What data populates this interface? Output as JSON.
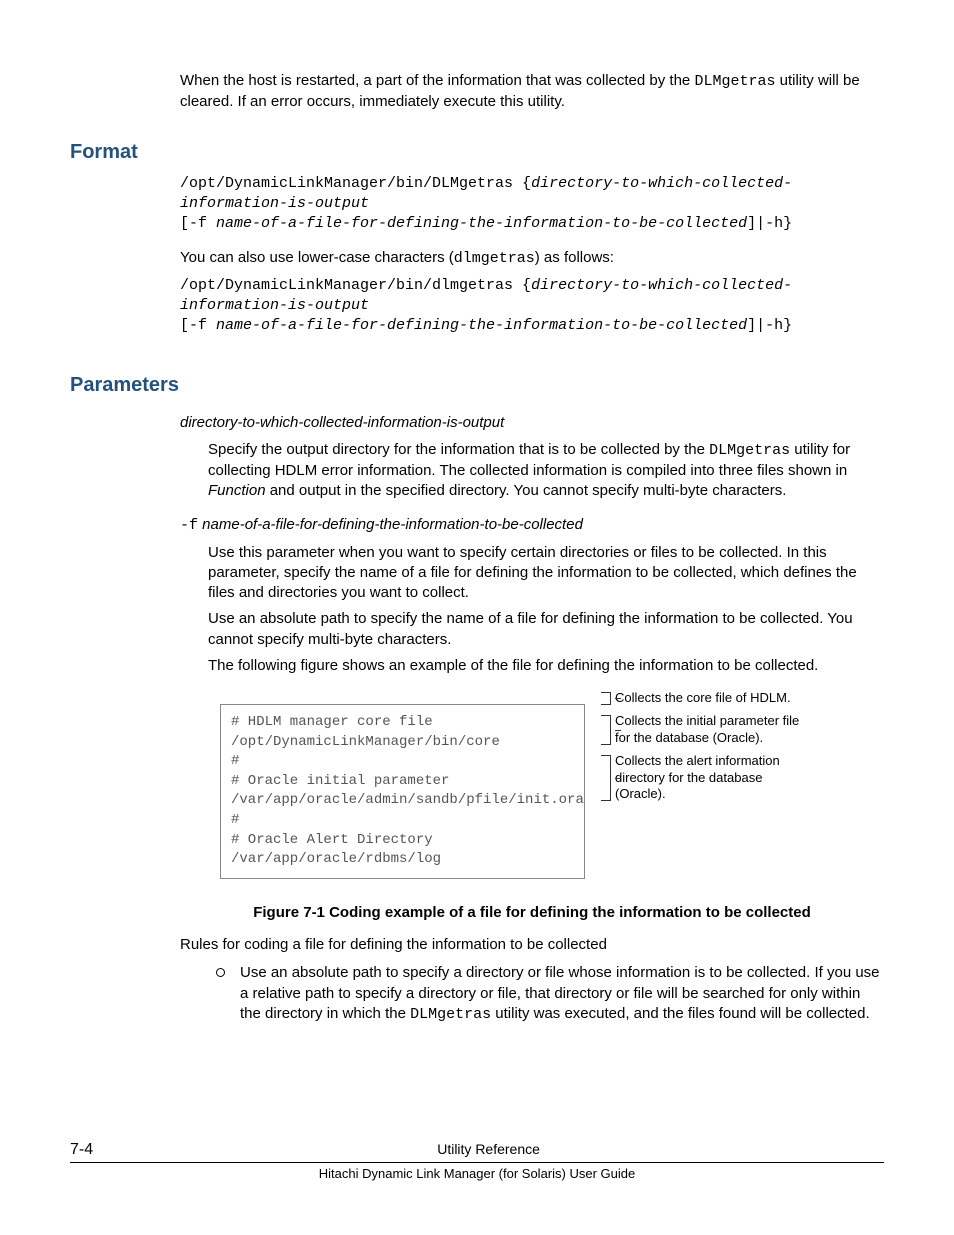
{
  "intro": {
    "p1a": "When the host is restarted, a part of the information that was collected by the ",
    "p1code": "DLMgetras",
    "p1b": " utility will be cleared. If an error occurs, immediately execute this utility."
  },
  "format": {
    "heading": "Format",
    "code1a": "/opt/DynamicLinkManager/bin/DLMgetras {",
    "code1b": "directory-to-which-collected-information-is-output",
    "code1c": "\n[-f ",
    "code1d": "name-of-a-file-for-defining-the-information-to-be-collected",
    "code1e": "]|-h}",
    "mid_a": "You can also use lower-case characters (",
    "mid_code": "dlmgetras",
    "mid_b": ") as follows:",
    "code2a": "/opt/DynamicLinkManager/bin/dlmgetras {",
    "code2b": "directory-to-which-collected-information-is-output",
    "code2c": "\n[-f ",
    "code2d": "name-of-a-file-for-defining-the-information-to-be-collected",
    "code2e": "]|-h}"
  },
  "parameters": {
    "heading": "Parameters",
    "p1_name": "directory-to-which-collected-information-is-output",
    "p1_body_a": "Specify the output directory for the information that is to be collected by the ",
    "p1_body_code": "DLMgetras",
    "p1_body_b": " utility for collecting HDLM error information. The collected information is compiled into three files shown in ",
    "p1_body_i": "Function",
    "p1_body_c": " and output in the specified directory. You cannot specify multi-byte characters.",
    "p2_flag": "-f",
    "p2_name": " name-of-a-file-for-defining-the-information-to-be-collected",
    "p2_body1": "Use this parameter when you want to specify certain directories or files to be collected. In this parameter, specify the name of a file for defining the information to be collected, which defines the files and directories you want to collect.",
    "p2_body2": "Use an absolute path to specify the name of a file for defining the information to be collected. You cannot specify multi-byte characters.",
    "p2_body3": "The following figure shows an example of the file for defining the information to be collected."
  },
  "figure": {
    "box": "# HDLM manager core file\n/opt/DynamicLinkManager/bin/core\n#\n# Oracle initial parameter\n/var/app/oracle/admin/sandb/pfile/init.ora\n#\n# Oracle Alert Directory\n/var/app/oracle/rdbms/log",
    "callouts": [
      "Collects the core file of HDLM.",
      "Collects the initial parameter file for the database (Oracle).",
      "Collects the alert information directory for the database (Oracle)."
    ],
    "caption": "Figure 7-1 Coding example of a file for defining the information to be collected"
  },
  "rules": {
    "intro": "Rules for coding a file for defining the information to be collected",
    "r1a": "Use an absolute path to specify a directory or file whose information is to be collected. If you use a relative path to specify a directory or file, that directory or file will be searched for only within the directory in which the ",
    "r1code": "DLMgetras",
    "r1b": " utility was executed, and the files found will be collected."
  },
  "footer": {
    "pagenum": "7-4",
    "section": "Utility Reference",
    "guide": "Hitachi Dynamic Link Manager (for Solaris) User Guide"
  }
}
